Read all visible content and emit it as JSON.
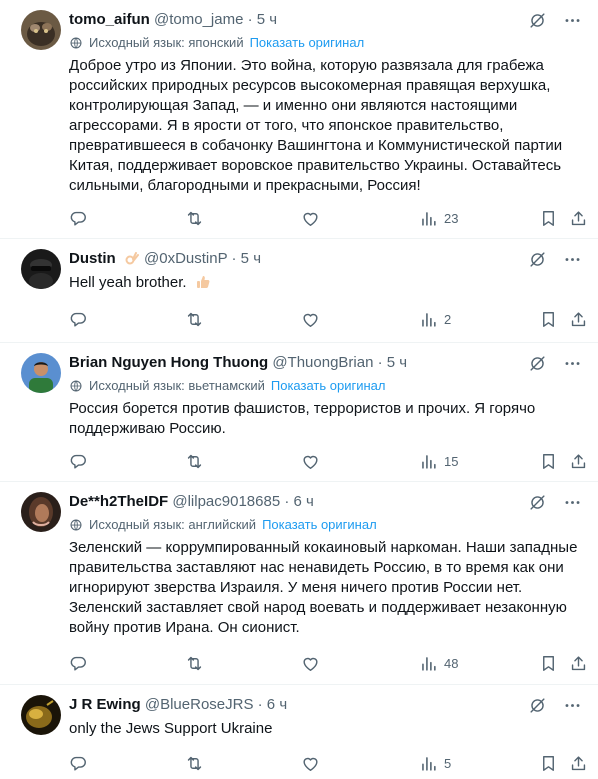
{
  "icons": {
    "grok": "grok-slash-icon",
    "more": "more-dots-icon",
    "translate": "globe-translate-icon",
    "reply": "reply-icon",
    "retweet": "retweet-icon",
    "like": "heart-icon",
    "views": "bar-chart-icon",
    "bookmark": "bookmark-icon",
    "share": "share-icon"
  },
  "colors": {
    "muted": "#536471",
    "link": "#1d9bf0",
    "text": "#0f1419"
  },
  "show_original_label": "Показать оригинал",
  "tweets": [
    {
      "name": "tomo_aifun",
      "handle": "@tomo_jame",
      "time": "· 5 ч",
      "translated_from": "Исходный язык: японский",
      "text": "Доброе утро из Японии. Это война, которую развязала для грабежа российских природных ресурсов высокомерная правящая верхушка, контролирующая Запад, — и именно они являются настоящими агрессорами. Я в ярости от того, что японское правительство, превратившееся в собачонку Вашингтона и Коммунистической партии Китая, поддерживает воровское правительство Украины. Оставайтесь сильными, благородными и прекрасными, Россия!",
      "views": "23"
    },
    {
      "name": "Dustin",
      "handle": "@0xDustinP",
      "time": "· 5 ч",
      "text": "Hell yeah brother.",
      "views": "2"
    },
    {
      "name": "Brian Nguyen Hong Thuong",
      "handle": "@ThuongBrian",
      "time": "· 5 ч",
      "translated_from": "Исходный язык: вьетнамский",
      "text": "Россия борется против фашистов, террористов и прочих. Я горячо поддерживаю Россию.",
      "views": "15"
    },
    {
      "name": "De**h2TheIDF",
      "handle": "@lilpac9018685",
      "time": "· 6 ч",
      "translated_from": "Исходный язык: английский",
      "text": "Зеленский — коррумпированный кокаиновый наркоман. Наши западные правительства заставляют нас ненавидеть Россию, в то время как они игнорируют зверства Израиля. У меня ничего против России нет. Зеленский заставляет свой народ воевать и поддерживает незаконную войну против Ирана. Он сионист.",
      "views": "48"
    },
    {
      "name": "J R Ewing",
      "handle": "@BlueRoseJRS",
      "time": "· 6 ч",
      "text": "only the Jews Support Ukraine",
      "views": "5"
    }
  ]
}
